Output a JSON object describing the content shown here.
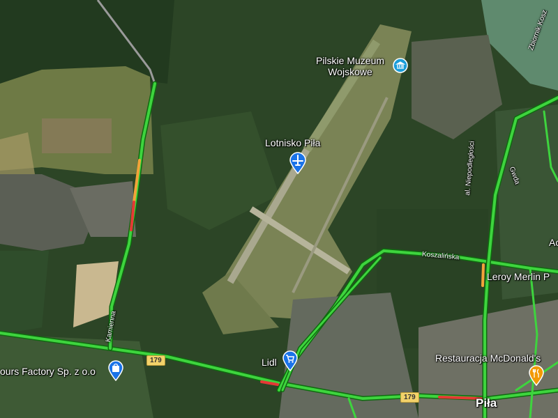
{
  "map": {
    "type": "satellite with traffic",
    "pois": {
      "museum": {
        "name": "Pilskie Muzeum\nWojskowe",
        "icon": "museum-icon",
        "color": "#1a9dd9"
      },
      "airport": {
        "name": "Lotnisko Piła",
        "icon": "airplane-icon",
        "color": "#1a73e8"
      },
      "lidl": {
        "name": "Lidl",
        "icon": "shopping-cart-icon",
        "color": "#1a73e8"
      },
      "factory": {
        "name": "ours Factory Sp. z o.o",
        "icon": "shopping-bag-icon",
        "color": "#1a73e8"
      },
      "leroy": {
        "name": "Leroy Merlin P"
      },
      "mcdonalds": {
        "name": "Restauracja McDonald's",
        "icon": "restaurant-icon",
        "color": "#f29900"
      },
      "edge_ac": {
        "name": "Ac"
      }
    },
    "city": "Piła",
    "streets": {
      "kamienna": "Kamienna",
      "koszalinska": "Koszalińska",
      "niepodleglosci": "al. Niepodległości",
      "gwda": "Gwda",
      "reservoir": "Zbiornik Kosz"
    },
    "road_shields": [
      "179",
      "179"
    ],
    "traffic_colors": {
      "free": "#3ed43e",
      "slow": "#f2a33a",
      "jam": "#e53935"
    }
  }
}
